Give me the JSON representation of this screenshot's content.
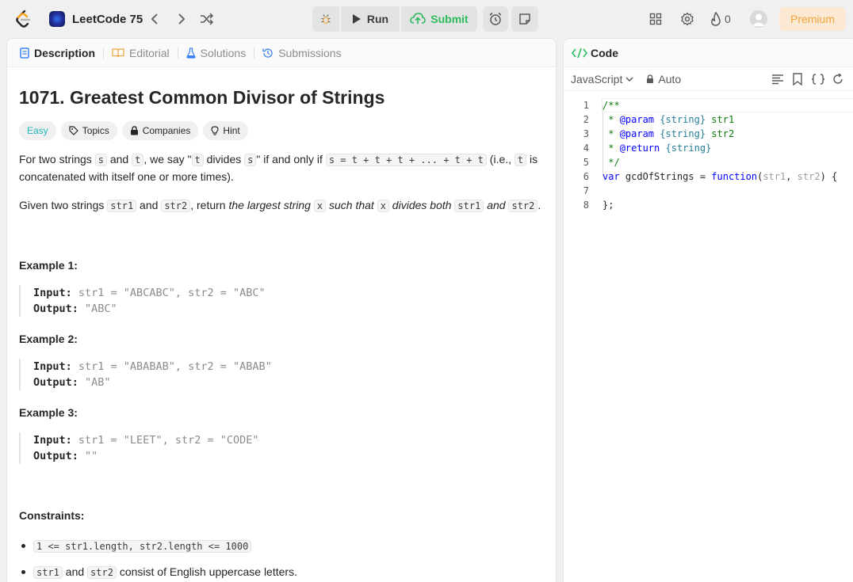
{
  "navbar": {
    "study_plan_title": "LeetCode 75",
    "run_label": "Run",
    "submit_label": "Submit",
    "streak_count": "0",
    "premium_label": "Premium"
  },
  "description_tabs": [
    {
      "label": "Description",
      "icon": "document-icon"
    },
    {
      "label": "Editorial",
      "icon": "book-icon"
    },
    {
      "label": "Solutions",
      "icon": "flask-icon"
    },
    {
      "label": "Submissions",
      "icon": "history-icon"
    }
  ],
  "problem": {
    "title": "1071. Greatest Common Divisor of Strings",
    "difficulty": "Easy",
    "chips": {
      "topics": "Topics",
      "companies": "Companies",
      "hint": "Hint"
    },
    "p1": {
      "a": "For two strings ",
      "s1": "s",
      "b": " and ",
      "t1": "t",
      "c": ", we say \"",
      "t2": "t",
      "d": " divides ",
      "s2": "s",
      "e": "\" if and only if ",
      "formula": "s = t + t + t + ... + t + t",
      "f": " (i.e., ",
      "t3": "t",
      "g": " is",
      "line2": "concatenated with itself one or more times)."
    },
    "p2": {
      "a": "Given two strings ",
      "str1": "str1",
      "b": " and ",
      "str2": "str2",
      "c": ", return ",
      "d": "the largest string ",
      "x1": "x",
      "e": " such that ",
      "x2": "x",
      "f": " divides both ",
      "str1b": "str1",
      "g": " and ",
      "str2b": "str2",
      "h": "."
    },
    "examples": [
      {
        "heading": "Example 1:",
        "input_label": "Input:",
        "input": " str1 = \"ABCABC\", str2 = \"ABC\"",
        "output_label": "Output:",
        "output": " \"ABC\""
      },
      {
        "heading": "Example 2:",
        "input_label": "Input:",
        "input": " str1 = \"ABABAB\", str2 = \"ABAB\"",
        "output_label": "Output:",
        "output": " \"AB\""
      },
      {
        "heading": "Example 3:",
        "input_label": "Input:",
        "input": " str1 = \"LEET\", str2 = \"CODE\"",
        "output_label": "Output:",
        "output": " \"\""
      }
    ],
    "constraints_heading": "Constraints:",
    "constraint1": "1 <= str1.length, str2.length <= 1000",
    "constraint2": {
      "a": "str1",
      "b": " and ",
      "c": "str2",
      "d": " consist of English uppercase letters."
    }
  },
  "code_panel": {
    "tab_label": "Code",
    "language": "JavaScript",
    "mode": "Auto",
    "lines": [
      "1",
      "2",
      "3",
      "4",
      "5",
      "6",
      "7",
      "8"
    ],
    "code": {
      "l1": "/**",
      "l2a": " * ",
      "l2b": "@param",
      "l2c": " ",
      "l2d": "{string}",
      "l2e": " str1",
      "l3a": " * ",
      "l3b": "@param",
      "l3c": " ",
      "l3d": "{string}",
      "l3e": " str2",
      "l4a": " * ",
      "l4b": "@return",
      "l4c": " ",
      "l4d": "{string}",
      "l5": " */",
      "l6a": "var",
      "l6b": " gcdOfStrings = ",
      "l6c": "function",
      "l6d": "(",
      "l6e": "str1",
      "l6f": ", ",
      "l6g": "str2",
      "l6h": ") {",
      "l7": "",
      "l8": "};"
    }
  },
  "colors": {
    "accent_green": "#2cbb5d",
    "easy": "#1cb8b8",
    "premium": "#f0a53a"
  }
}
